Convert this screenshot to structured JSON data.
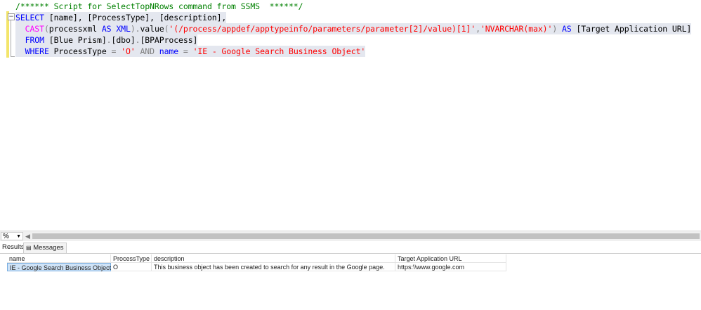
{
  "editor": {
    "lines": [
      [
        {
          "t": "/****** Script for SelectTopNRows command from SSMS  ******/",
          "c": "cm"
        }
      ],
      [
        {
          "t": "SELECT",
          "c": "kw"
        },
        {
          "t": " [name], [ProcessType], [description],",
          "c": "tx"
        }
      ],
      [
        {
          "t": "  ",
          "c": "tx"
        },
        {
          "t": "CAST",
          "c": "fn"
        },
        {
          "t": "(",
          "c": "op"
        },
        {
          "t": "processxml ",
          "c": "tx"
        },
        {
          "t": "AS",
          "c": "kw"
        },
        {
          "t": " ",
          "c": "tx"
        },
        {
          "t": "XML",
          "c": "kw"
        },
        {
          "t": ").",
          "c": "op"
        },
        {
          "t": "value",
          "c": "tx"
        },
        {
          "t": "(",
          "c": "op"
        },
        {
          "t": "'(/process/appdef/apptypeinfo/parameters/parameter[2]/value)[1]'",
          "c": "str"
        },
        {
          "t": ",",
          "c": "op"
        },
        {
          "t": "'NVARCHAR(max)'",
          "c": "str"
        },
        {
          "t": ")",
          "c": "op"
        },
        {
          "t": " ",
          "c": "tx"
        },
        {
          "t": "AS",
          "c": "kw"
        },
        {
          "t": " [Target Application URL]",
          "c": "tx"
        }
      ],
      [
        {
          "t": "  ",
          "c": "tx"
        },
        {
          "t": "FROM",
          "c": "kw"
        },
        {
          "t": " [Blue Prism]",
          "c": "tx"
        },
        {
          "t": ".",
          "c": "op"
        },
        {
          "t": "[dbo]",
          "c": "tx"
        },
        {
          "t": ".",
          "c": "op"
        },
        {
          "t": "[BPAProcess]",
          "c": "tx"
        }
      ],
      [
        {
          "t": "  ",
          "c": "tx"
        },
        {
          "t": "WHERE",
          "c": "kw"
        },
        {
          "t": " ProcessType ",
          "c": "tx"
        },
        {
          "t": "=",
          "c": "op"
        },
        {
          "t": " ",
          "c": "tx"
        },
        {
          "t": "'O'",
          "c": "str"
        },
        {
          "t": " ",
          "c": "tx"
        },
        {
          "t": "AND",
          "c": "op"
        },
        {
          "t": " ",
          "c": "tx"
        },
        {
          "t": "name",
          "c": "kw"
        },
        {
          "t": " ",
          "c": "tx"
        },
        {
          "t": "=",
          "c": "op"
        },
        {
          "t": " ",
          "c": "tx"
        },
        {
          "t": "'IE - Google Search Business Object'",
          "c": "str"
        }
      ]
    ]
  },
  "toolbar": {
    "zoom_value": "%"
  },
  "tabs": {
    "results": "Results",
    "messages": "Messages"
  },
  "grid": {
    "headers": [
      "name",
      "ProcessType",
      "description",
      "Target Application URL"
    ],
    "rows": [
      [
        "IE - Google Search Business Object",
        "O",
        "This business object has been created to search for any result in the Google page.",
        "https:\\\\www.google.com"
      ]
    ]
  }
}
